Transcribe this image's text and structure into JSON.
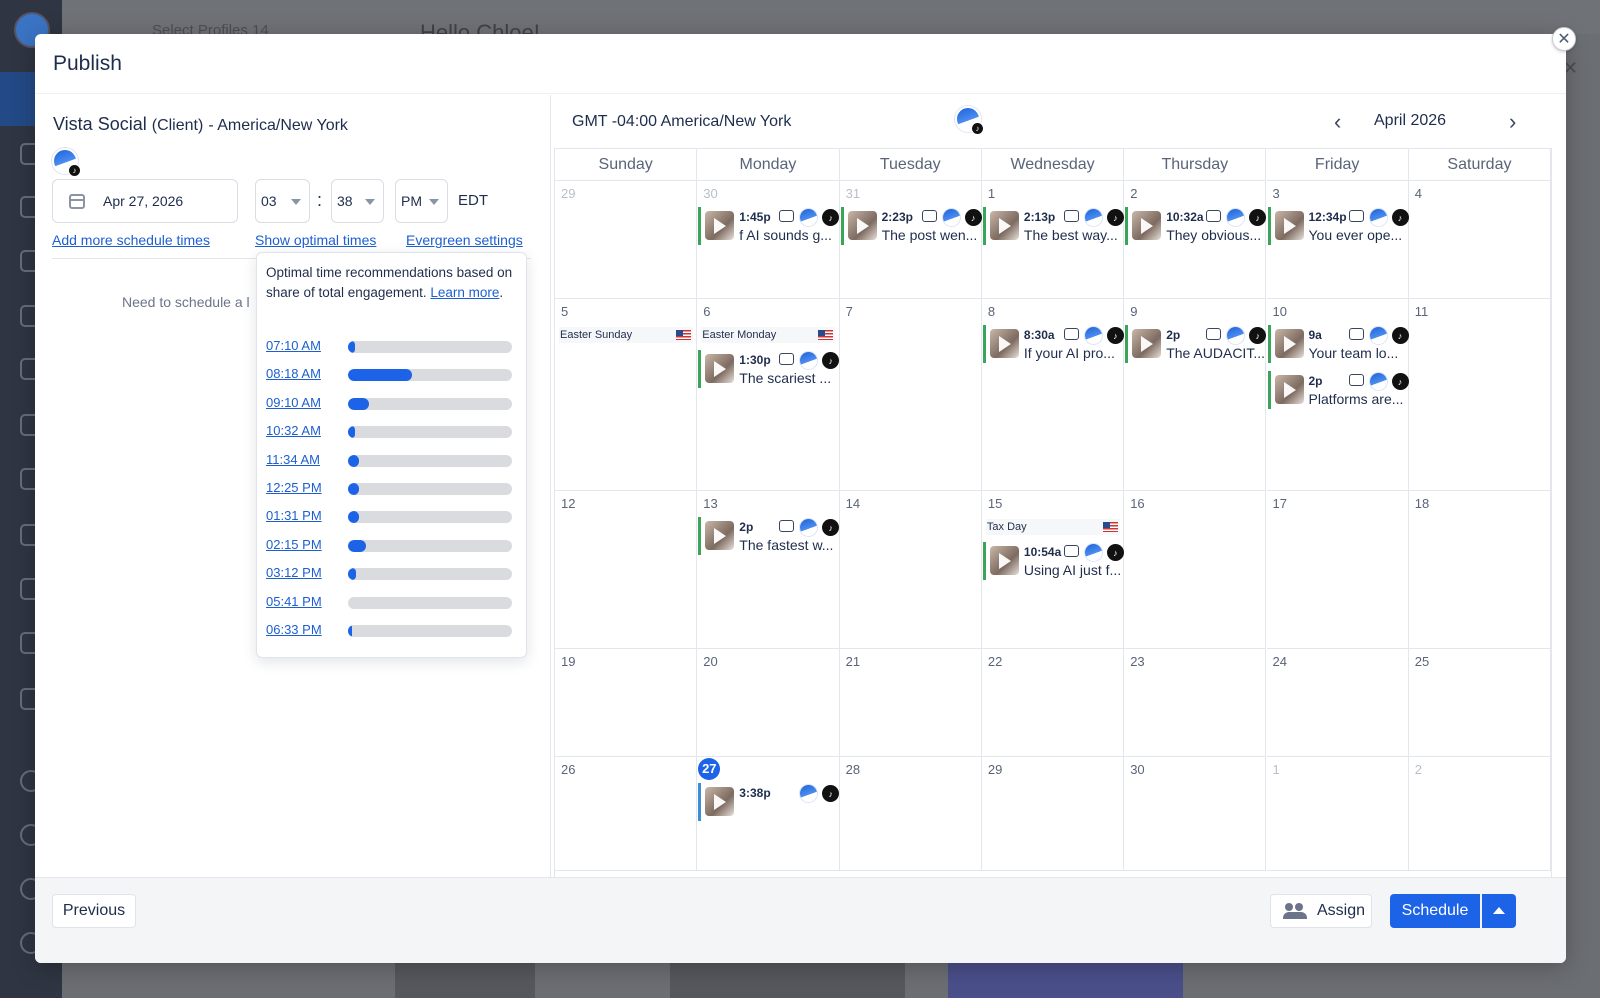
{
  "background": {
    "profiles_label": "Select Profiles  14",
    "greeting": "Hello Chloe!"
  },
  "modal": {
    "title": "Publish",
    "close_icon": "close-icon"
  },
  "left": {
    "profile_name": "Vista Social",
    "profile_role": "(Client)",
    "profile_tz": "- America/New York",
    "date_value": "Apr 27, 2026",
    "hour": "03",
    "minute": "38",
    "ampm": "PM",
    "tz_abbr": "EDT",
    "links": {
      "add_times": "Add more schedule times",
      "optimal": "Show optimal times",
      "evergreen": "Evergreen settings"
    },
    "need_text": "Need to schedule a l"
  },
  "optimal": {
    "desc": "Optimal time recommendations based on share of total engagement.",
    "learn_more": "Learn more",
    "period": ".",
    "times": [
      {
        "label": "07:10 AM",
        "share": 0.04
      },
      {
        "label": "08:18 AM",
        "share": 0.39
      },
      {
        "label": "09:10 AM",
        "share": 0.13
      },
      {
        "label": "10:32 AM",
        "share": 0.04
      },
      {
        "label": "11:34 AM",
        "share": 0.07
      },
      {
        "label": "12:25 PM",
        "share": 0.07
      },
      {
        "label": "01:31 PM",
        "share": 0.07
      },
      {
        "label": "02:15 PM",
        "share": 0.11
      },
      {
        "label": "03:12 PM",
        "share": 0.05
      },
      {
        "label": "05:41 PM",
        "share": 0.0
      },
      {
        "label": "06:33 PM",
        "share": 0.01
      }
    ]
  },
  "calendar": {
    "tz_label": "GMT -04:00 America/New York",
    "month": "April 2026",
    "weekdays": [
      "Sunday",
      "Monday",
      "Tuesday",
      "Wednesday",
      "Thursday",
      "Friday",
      "Saturday"
    ],
    "weeks": [
      [
        {
          "d": "29",
          "dim": true
        },
        {
          "d": "30",
          "dim": true,
          "posts": [
            {
              "time": "1:45p",
              "text": "f AI sounds g..."
            }
          ]
        },
        {
          "d": "31",
          "dim": true,
          "posts": [
            {
              "time": "2:23p",
              "text": "The post wen..."
            }
          ]
        },
        {
          "d": "1",
          "posts": [
            {
              "time": "2:13p",
              "text": "The best way..."
            }
          ]
        },
        {
          "d": "2",
          "posts": [
            {
              "time": "10:32a",
              "text": "They obvious..."
            }
          ]
        },
        {
          "d": "3",
          "posts": [
            {
              "time": "12:34p",
              "text": "You ever ope..."
            }
          ]
        },
        {
          "d": "4"
        }
      ],
      [
        {
          "d": "5",
          "holiday": "Easter Sunday"
        },
        {
          "d": "6",
          "holiday": "Easter Monday",
          "posts": [
            {
              "time": "1:30p",
              "text": "The scariest ..."
            }
          ]
        },
        {
          "d": "7"
        },
        {
          "d": "8",
          "posts": [
            {
              "time": "8:30a",
              "text": "If your AI pro..."
            }
          ]
        },
        {
          "d": "9",
          "posts": [
            {
              "time": "2p",
              "text": "The AUDACIT..."
            }
          ]
        },
        {
          "d": "10",
          "posts": [
            {
              "time": "9a",
              "text": "Your team lo..."
            },
            {
              "time": "2p",
              "text": "Platforms are..."
            }
          ]
        },
        {
          "d": "11"
        }
      ],
      [
        {
          "d": "12"
        },
        {
          "d": "13",
          "posts": [
            {
              "time": "2p",
              "text": "The fastest w..."
            }
          ]
        },
        {
          "d": "14"
        },
        {
          "d": "15",
          "holiday": "Tax Day",
          "posts": [
            {
              "time": "10:54a",
              "text": "Using AI just f..."
            }
          ]
        },
        {
          "d": "16"
        },
        {
          "d": "17"
        },
        {
          "d": "18"
        }
      ],
      [
        {
          "d": "19"
        },
        {
          "d": "20"
        },
        {
          "d": "21"
        },
        {
          "d": "22"
        },
        {
          "d": "23"
        },
        {
          "d": "24"
        },
        {
          "d": "25"
        }
      ],
      [
        {
          "d": "26"
        },
        {
          "d": "27",
          "today": true,
          "posts": [
            {
              "time": "3:38p",
              "text": "",
              "draft": true,
              "novideo": true
            }
          ]
        },
        {
          "d": "28"
        },
        {
          "d": "29"
        },
        {
          "d": "30"
        },
        {
          "d": "1",
          "dim": true
        },
        {
          "d": "2",
          "dim": true
        }
      ]
    ]
  },
  "footer": {
    "previous": "Previous",
    "assign": "Assign",
    "schedule": "Schedule"
  }
}
